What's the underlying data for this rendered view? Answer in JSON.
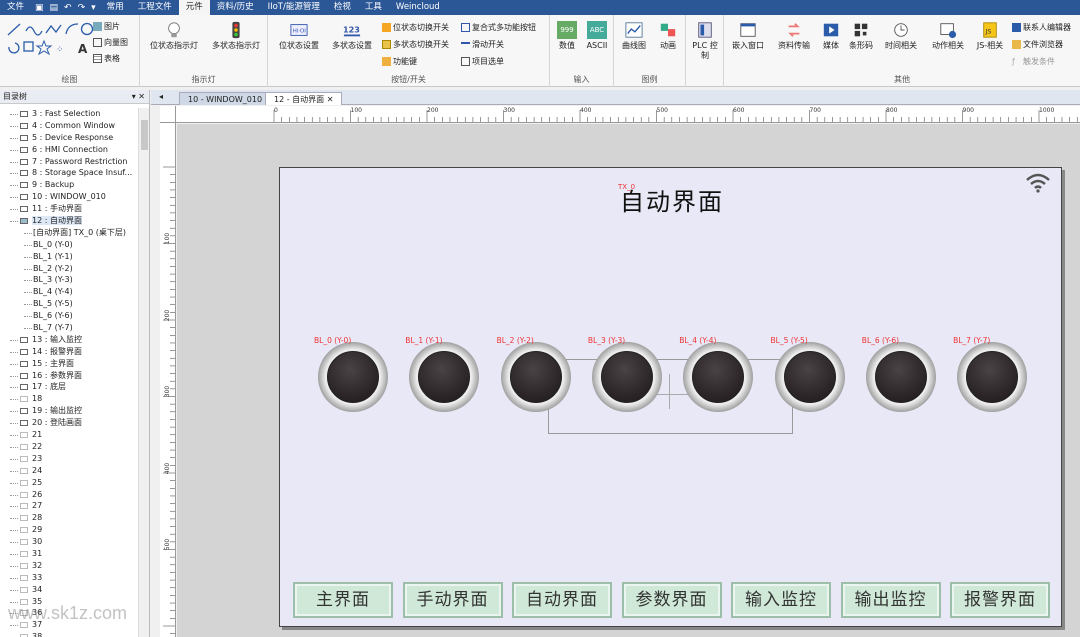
{
  "menu": {
    "items": [
      "文件",
      "常用",
      "工程文件",
      "元件",
      "资料/历史",
      "IIoT/能源管理",
      "检视",
      "工具",
      "Weincloud"
    ],
    "active_index": 3
  },
  "ribbon": {
    "draw": {
      "label": "绘图",
      "picture": "图片",
      "vector": "向量图",
      "table": "表格"
    },
    "indicator": {
      "label": "指示灯",
      "bit_lamp": "位状态指示灯",
      "multi_lamp": "多状态指示灯"
    },
    "buttons": {
      "label": "按钮/开关",
      "bit_set": "位状态设置",
      "multi_set": "多状态设置",
      "bit_switch": "位状态切换开关",
      "multi_switch": "多状态切换开关",
      "function_key": "功能键",
      "combo": "复合式多功能按钮",
      "slide": "滑动开关",
      "item_select": "项目选单"
    },
    "input": {
      "label": "输入",
      "numeric": "数值",
      "ascii": "ASCII",
      "numeric_icon": "999",
      "ascii_icon": "ABC"
    },
    "chart": {
      "label": "图例",
      "trend": "曲线图",
      "animation": "动画"
    },
    "plc": {
      "label": "PLC 控制"
    },
    "other": {
      "label": "其他",
      "embed": "嵌入窗口",
      "transfer": "资料传输",
      "media": "媒体",
      "barcode": "条形码",
      "time": "时间相关",
      "action": "动作相关",
      "js": "JS-相关",
      "contact": "联系人编辑器",
      "browser": "文件浏览器",
      "trigger": "触发条件"
    }
  },
  "left_panel": {
    "title": "目录树",
    "items": [
      {
        "label": "3 : Fast Selection",
        "type": "window"
      },
      {
        "label": "4 : Common Window",
        "type": "window"
      },
      {
        "label": "5 : Device Response",
        "type": "window"
      },
      {
        "label": "6 : HMI Connection",
        "type": "window"
      },
      {
        "label": "7 : Password Restriction",
        "type": "window"
      },
      {
        "label": "8 : Storage Space Insuf...",
        "type": "window"
      },
      {
        "label": "9 : Backup",
        "type": "window"
      },
      {
        "label": "10 : WINDOW_010",
        "type": "window"
      },
      {
        "label": "11 : 手动界面",
        "type": "window"
      },
      {
        "label": "12 : 自动界面",
        "type": "window",
        "selected": true
      },
      {
        "label": "[自动界面] TX_0 (桌下层)",
        "type": "sub"
      },
      {
        "label": "BL_0 (Y-0)",
        "type": "sub"
      },
      {
        "label": "BL_1 (Y-1)",
        "type": "sub"
      },
      {
        "label": "BL_2 (Y-2)",
        "type": "sub"
      },
      {
        "label": "BL_3 (Y-3)",
        "type": "sub"
      },
      {
        "label": "BL_4 (Y-4)",
        "type": "sub"
      },
      {
        "label": "BL_5 (Y-5)",
        "type": "sub"
      },
      {
        "label": "BL_6 (Y-6)",
        "type": "sub"
      },
      {
        "label": "BL_7 (Y-7)",
        "type": "sub"
      },
      {
        "label": "13 : 输入监控",
        "type": "window"
      },
      {
        "label": "14 : 报警界面",
        "type": "window"
      },
      {
        "label": "15 : 主界面",
        "type": "window"
      },
      {
        "label": "16 : 参数界面",
        "type": "window"
      },
      {
        "label": "17 : 底层",
        "type": "window"
      },
      {
        "label": "18",
        "type": "empty"
      },
      {
        "label": "19 : 输出监控",
        "type": "window"
      },
      {
        "label": "20 : 登陆画面",
        "type": "window"
      },
      {
        "label": "21",
        "type": "empty"
      },
      {
        "label": "22",
        "type": "empty"
      },
      {
        "label": "23",
        "type": "empty"
      },
      {
        "label": "24",
        "type": "empty"
      },
      {
        "label": "25",
        "type": "empty"
      },
      {
        "label": "26",
        "type": "empty"
      },
      {
        "label": "27",
        "type": "empty"
      },
      {
        "label": "28",
        "type": "empty"
      },
      {
        "label": "29",
        "type": "empty"
      },
      {
        "label": "30",
        "type": "empty"
      },
      {
        "label": "31",
        "type": "empty"
      },
      {
        "label": "32",
        "type": "empty"
      },
      {
        "label": "33",
        "type": "empty"
      },
      {
        "label": "34",
        "type": "empty"
      },
      {
        "label": "35",
        "type": "empty"
      },
      {
        "label": "36",
        "type": "empty"
      },
      {
        "label": "37",
        "type": "empty"
      },
      {
        "label": "38",
        "type": "empty"
      }
    ]
  },
  "tabs": [
    {
      "label": "10 - WINDOW_010",
      "active": false
    },
    {
      "label": "12 - 自动界面",
      "active": true
    }
  ],
  "ruler": {
    "h_marks": [
      "0",
      "100",
      "200",
      "300",
      "400",
      "500",
      "600",
      "700",
      "800",
      "900",
      "1000"
    ],
    "v_marks": [
      "100",
      "200",
      "300",
      "400",
      "500"
    ]
  },
  "screen": {
    "title": "自动界面",
    "title_tag": "TX_0",
    "lamps": [
      "BL_0 (Y-0)",
      "BL_1 (Y-1)",
      "BL_2 (Y-2)",
      "BL_3 (Y-3)",
      "BL_4 (Y-4)",
      "BL_5 (Y-5)",
      "BL_6 (Y-6)",
      "BL_7 (Y-7)"
    ],
    "nav_buttons": [
      "主界面",
      "手动界面",
      "自动界面",
      "参数界面",
      "输入监控",
      "输出监控",
      "报警界面"
    ]
  },
  "watermark": "www.sk1z.com",
  "colors": {
    "menubar": "#2b5797",
    "lamp_off": "#2e272a",
    "nav_button": "#cfe8d8",
    "label_red": "#e33333"
  }
}
